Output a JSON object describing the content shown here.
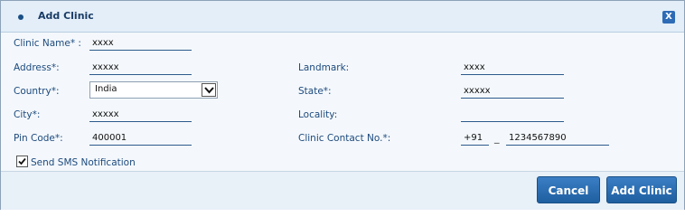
{
  "dialog": {
    "title": "Add Clinic",
    "close_label": "X"
  },
  "form": {
    "clinic_name": {
      "label": "Clinic Name* :",
      "value": "xxxx"
    },
    "address": {
      "label": "Address*:",
      "value": "xxxxx"
    },
    "landmark": {
      "label": "Landmark:",
      "value": "xxxx"
    },
    "country": {
      "label": "Country*:",
      "value": "India"
    },
    "state": {
      "label": "State*:",
      "value": "xxxxx"
    },
    "city": {
      "label": "City*:",
      "value": "xxxxx"
    },
    "locality": {
      "label": "Locality:",
      "value": ""
    },
    "pin_code": {
      "label": "Pin Code*:",
      "value": "400001"
    },
    "contact": {
      "label": "Clinic Contact No.*:",
      "code": "+91",
      "separator": "_",
      "number": "1234567890"
    },
    "send_sms": {
      "label": "Send SMS Notification",
      "checked": true
    }
  },
  "buttons": {
    "cancel": "Cancel",
    "add_clinic": "Add Clinic"
  },
  "colors": {
    "label": "#1d4a7d",
    "button": "#2d6bb6"
  }
}
